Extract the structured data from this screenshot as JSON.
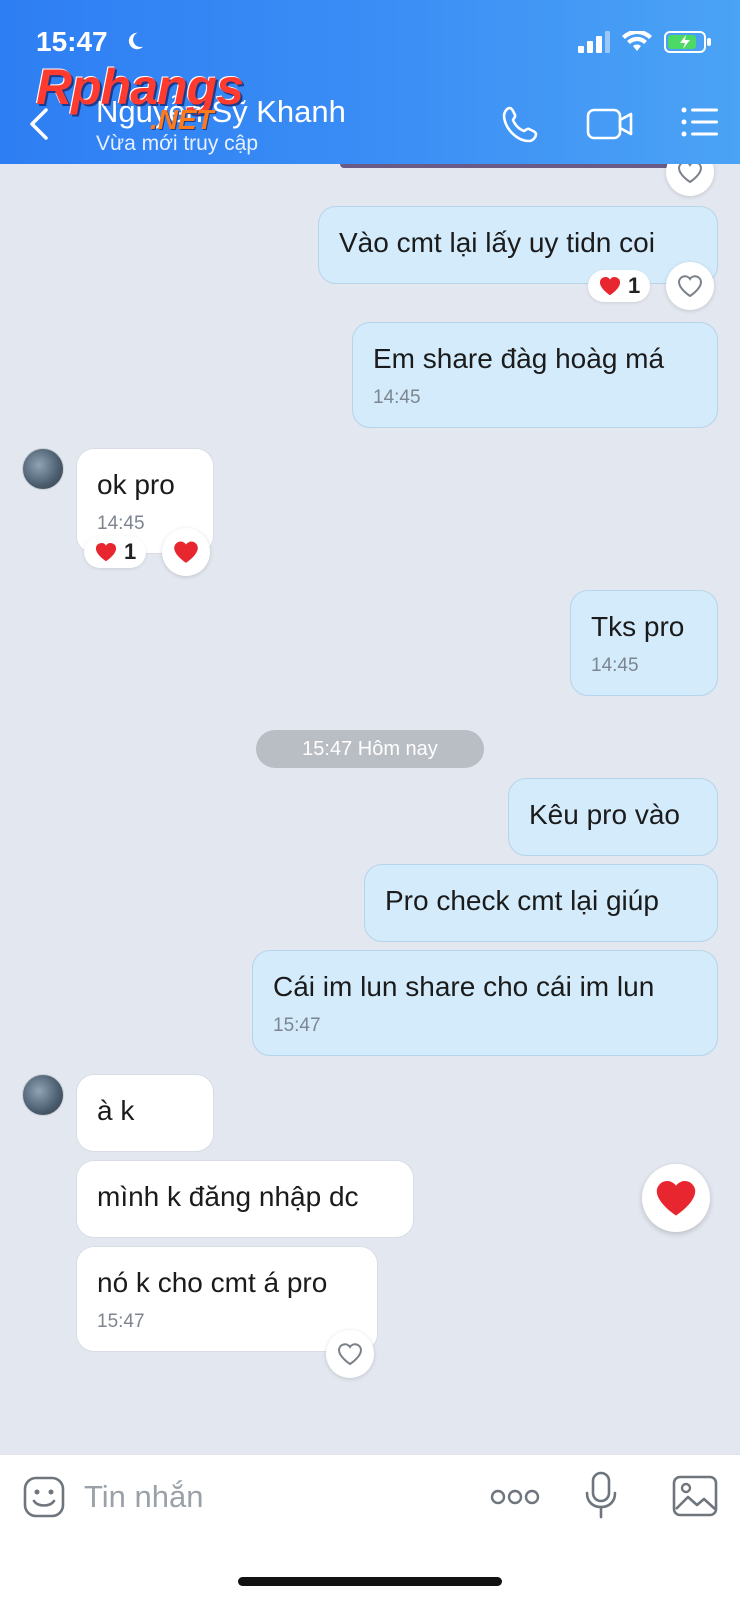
{
  "status_bar": {
    "time": "15:47"
  },
  "watermark": {
    "brand": "Rphangs",
    "suffix": ".NET"
  },
  "header": {
    "contact_name": "Nguyễn Sỹ Khanh",
    "contact_status": "Vừa mới truy cập"
  },
  "messages": [
    {
      "dir": "out",
      "text": "Vào cmt lại lấy uy tidn coi",
      "time": "",
      "reaction_count": "1"
    },
    {
      "dir": "out",
      "text": "Em share đàg hoàg má",
      "time": "14:45"
    },
    {
      "dir": "in",
      "text": "ok pro",
      "time": "14:45",
      "reaction_count": "1"
    },
    {
      "dir": "out",
      "text": "Tks pro",
      "time": "14:45"
    },
    {
      "dir": "out",
      "text": "Kêu pro vào",
      "time": ""
    },
    {
      "dir": "out",
      "text": "Pro check cmt lại giúp",
      "time": ""
    },
    {
      "dir": "out",
      "text": "Cái im lun share cho cái im lun",
      "time": "15:47"
    },
    {
      "dir": "in",
      "text": "à k",
      "time": ""
    },
    {
      "dir": "in",
      "text": "mình k đăng nhập dc",
      "time": ""
    },
    {
      "dir": "in",
      "text": "nó k cho cmt á pro",
      "time": "15:47"
    }
  ],
  "date_separator": "15:47 Hôm nay",
  "input": {
    "placeholder": "Tin nhắn"
  },
  "colors": {
    "header": "#3a8df5",
    "bubble_out": "#d3ebfb",
    "bubble_in": "#ffffff",
    "heart": "#e8262f"
  }
}
